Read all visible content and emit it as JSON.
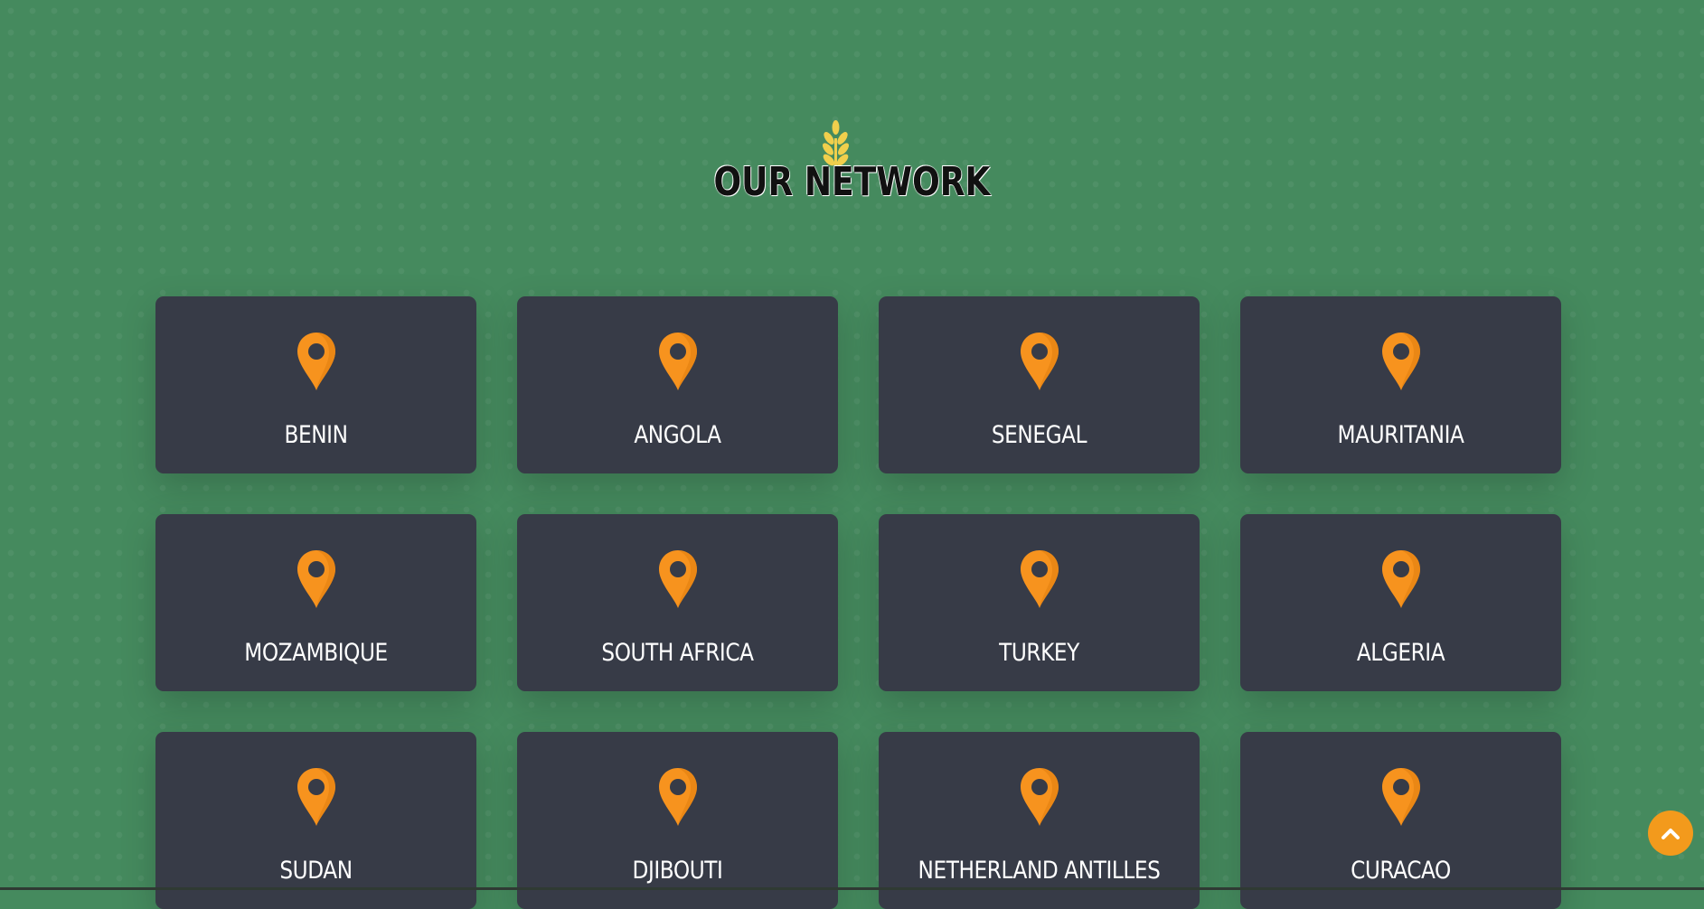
{
  "section": {
    "title": "OUR NETWORK"
  },
  "accent_colors": {
    "background": "#458a5e",
    "card": "#373b47",
    "pin": "#f7931e",
    "wheat": "#f0cf4c",
    "scroll_button": "#f39a1c"
  },
  "icons": {
    "heading": "wheat-icon",
    "card": "map-pin-icon",
    "scroll": "chevron-up-icon"
  },
  "locations": [
    {
      "name": "BENIN"
    },
    {
      "name": "ANGOLA"
    },
    {
      "name": "SENEGAL"
    },
    {
      "name": "MAURITANIA"
    },
    {
      "name": "MOZAMBIQUE"
    },
    {
      "name": "SOUTH AFRICA"
    },
    {
      "name": "TURKEY"
    },
    {
      "name": "ALGERIA"
    },
    {
      "name": "SUDAN"
    },
    {
      "name": "DJIBOUTI"
    },
    {
      "name": "NETHERLAND ANTILLES"
    },
    {
      "name": "CURACAO"
    }
  ]
}
